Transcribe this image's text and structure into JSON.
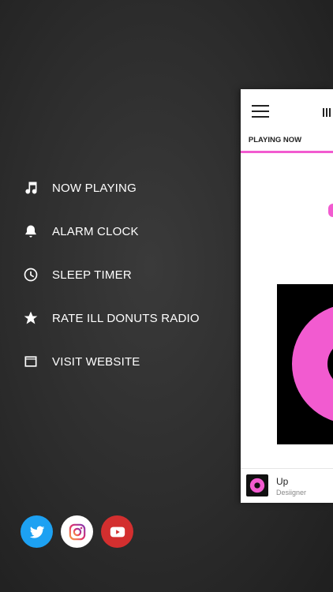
{
  "menu": {
    "items": [
      {
        "label": "NOW PLAYING",
        "icon": "music-note-icon"
      },
      {
        "label": "ALARM CLOCK",
        "icon": "alarm-bell-icon"
      },
      {
        "label": "SLEEP TIMER",
        "icon": "clock-icon"
      },
      {
        "label": "RATE ILL DONUTS RADIO",
        "icon": "star-icon"
      },
      {
        "label": "VISIT WEBSITE",
        "icon": "browser-window-icon"
      }
    ]
  },
  "social": {
    "items": [
      {
        "icon": "twitter-icon",
        "color": "#1da1f2"
      },
      {
        "icon": "instagram-icon",
        "color": "#ffffff"
      },
      {
        "icon": "youtube-icon",
        "color": "#d32f2f"
      }
    ]
  },
  "panel": {
    "tab_label": "PLAYING NOW",
    "accent_color": "#f25bd0",
    "now_playing": {
      "title": "Up",
      "artist": "Desiigner"
    }
  }
}
